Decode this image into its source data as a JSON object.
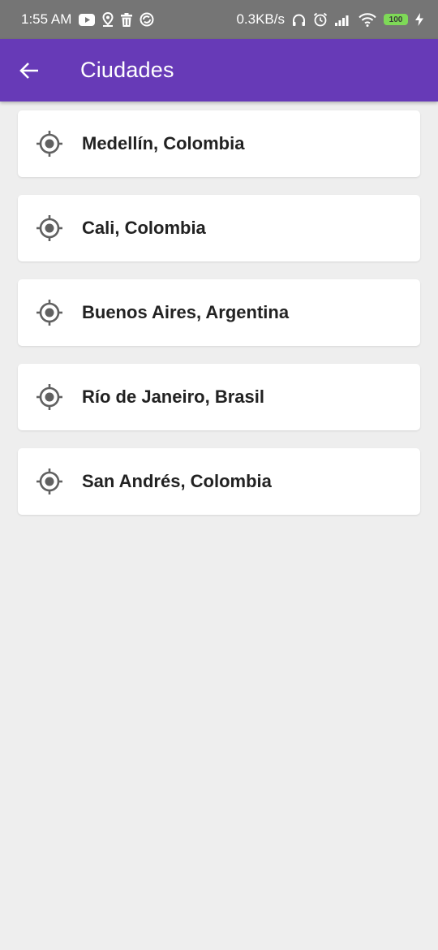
{
  "status_bar": {
    "time": "1:55 AM",
    "net_speed": "0.3KB/s",
    "battery": "100",
    "icons_left": [
      "youtube-icon",
      "location-pin-icon",
      "trash-icon",
      "sync-icon"
    ],
    "icons_right": [
      "headphones-icon",
      "alarm-icon",
      "signal-icon",
      "wifi-icon",
      "battery-icon",
      "charging-icon"
    ]
  },
  "app_bar": {
    "title": "Ciudades",
    "back_icon": "arrow-back-icon",
    "color": "#673ab7"
  },
  "cities": [
    {
      "label": "Medellín, Colombia",
      "icon": "gps-target-icon"
    },
    {
      "label": "Cali, Colombia",
      "icon": "gps-target-icon"
    },
    {
      "label": "Buenos Aires, Argentina",
      "icon": "gps-target-icon"
    },
    {
      "label": "Río de Janeiro, Brasil",
      "icon": "gps-target-icon"
    },
    {
      "label": "San Andrés, Colombia",
      "icon": "gps-target-icon"
    }
  ],
  "colors": {
    "status_bar": "#757575",
    "background": "#eeeeee",
    "card": "#ffffff",
    "icon": "#616161",
    "text": "#222222"
  }
}
